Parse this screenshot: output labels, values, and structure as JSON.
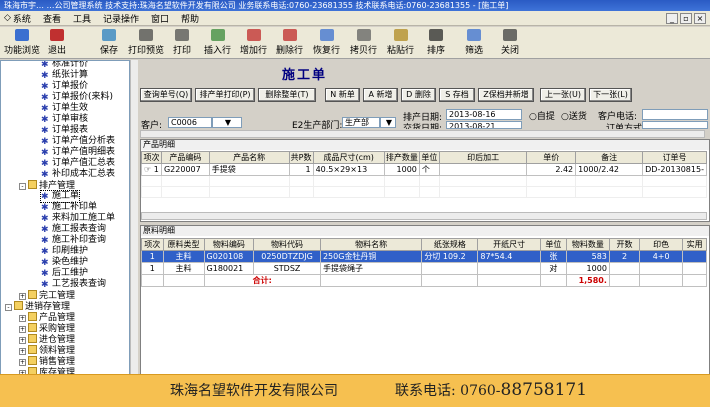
{
  "window": {
    "title": "珠海市宇…   …公司管理系统  技术支持:珠海名望软件开发有限公司  业务联系电话:0760-23681355  技术联系电话:0760-23681355 - [施工单]"
  },
  "menu": [
    "系统",
    "查看",
    "工具",
    "记录操作",
    "窗口",
    "帮助"
  ],
  "toolbar_left": [
    {
      "label": "功能浏览",
      "icon": "browse-icon"
    },
    {
      "label": "退出",
      "icon": "exit-icon"
    }
  ],
  "toolbar": [
    {
      "label": "保存",
      "icon": "save-icon"
    },
    {
      "label": "打印预览",
      "icon": "print-preview-icon"
    },
    {
      "label": "打印",
      "icon": "print-icon"
    },
    {
      "label": "插入行",
      "icon": "insert-row-icon"
    },
    {
      "label": "增加行",
      "icon": "add-row-icon"
    },
    {
      "label": "删除行",
      "icon": "delete-row-icon"
    },
    {
      "label": "恢复行",
      "icon": "restore-row-icon"
    },
    {
      "label": "拷贝行",
      "icon": "copy-row-icon"
    },
    {
      "label": "粘贴行",
      "icon": "paste-row-icon"
    },
    {
      "label": "排序",
      "icon": "sort-icon"
    },
    {
      "label": "筛选",
      "icon": "filter-icon"
    },
    {
      "label": "关闭",
      "icon": "close-icon"
    }
  ],
  "tree": [
    {
      "label": "标准计价",
      "type": "leaf",
      "level": 2
    },
    {
      "label": "纸张计算",
      "type": "leaf",
      "level": 2
    },
    {
      "label": "订单报价",
      "type": "leaf",
      "level": 2
    },
    {
      "label": "订单报价(来料)",
      "type": "leaf",
      "level": 2
    },
    {
      "label": "订单生效",
      "type": "leaf",
      "level": 2
    },
    {
      "label": "订单审核",
      "type": "leaf",
      "level": 2
    },
    {
      "label": "订单报表",
      "type": "leaf",
      "level": 2
    },
    {
      "label": "订单产值分析表",
      "type": "leaf",
      "level": 2
    },
    {
      "label": "订单产值明细表",
      "type": "leaf",
      "level": 2
    },
    {
      "label": "订单产值汇总表",
      "type": "leaf",
      "level": 2
    },
    {
      "label": "补印成本汇总表",
      "type": "leaf",
      "level": 2
    },
    {
      "label": "排产管理",
      "type": "folder",
      "level": 1,
      "expander": "-"
    },
    {
      "label": "施工单",
      "type": "leaf",
      "level": 2
    },
    {
      "label": "施工补印单",
      "type": "leaf",
      "level": 2
    },
    {
      "label": "来料加工施工单",
      "type": "leaf",
      "level": 2
    },
    {
      "label": "施工报表查询",
      "type": "leaf",
      "level": 2
    },
    {
      "label": "施工补印查询",
      "type": "leaf",
      "level": 2
    },
    {
      "label": "印刷维护",
      "type": "leaf",
      "level": 2
    },
    {
      "label": "染色维护",
      "type": "leaf",
      "level": 2
    },
    {
      "label": "后工维护",
      "type": "leaf",
      "level": 2
    },
    {
      "label": "工艺报表查询",
      "type": "leaf",
      "level": 2
    },
    {
      "label": "完工管理",
      "type": "folder",
      "level": 1,
      "expander": "+"
    },
    {
      "label": "进销存管理",
      "type": "folder",
      "level": 0,
      "expander": "-"
    },
    {
      "label": "产品管理",
      "type": "folder",
      "level": 1,
      "expander": "+"
    },
    {
      "label": "采购管理",
      "type": "folder",
      "level": 1,
      "expander": "+"
    },
    {
      "label": "进仓管理",
      "type": "folder",
      "level": 1,
      "expander": "+"
    },
    {
      "label": "领料管理",
      "type": "folder",
      "level": 1,
      "expander": "+"
    },
    {
      "label": "销售管理",
      "type": "folder",
      "level": 1,
      "expander": "+"
    },
    {
      "label": "库存管理",
      "type": "folder",
      "level": 1,
      "expander": "+"
    },
    {
      "label": "委外加工",
      "type": "folder",
      "level": 1,
      "expander": "+"
    }
  ],
  "form": {
    "title": "施工单",
    "buttons_row1": [
      "查询单号(Q)",
      "排产单打印(P)",
      "删除整单(T)"
    ],
    "buttons_row1b": [
      "N 新单",
      "A 新增",
      "D 删除",
      "S 存档",
      "Z保档并新增"
    ],
    "nav_buttons": [
      "上一张(U)",
      "下一张(L)"
    ],
    "schedule_date_label": "排产日期:",
    "schedule_date": "2013-08-16",
    "order_date_label": "交货日期:",
    "order_date": "2013-08-21",
    "radio_self": "自提",
    "radio_delivery": "送货",
    "customer_phone_label": "客户电话:",
    "customer_label": "客户:",
    "customer_value": "C0006",
    "dept_label": "E2生产部门:",
    "dept_value": "生产部",
    "order_method_label": "订单方式"
  },
  "product_section": {
    "title": "产品明细",
    "columns": [
      "项次",
      "产品编码",
      "产品名称",
      "共P数",
      "成品尺寸(cm)",
      "排产数量",
      "单位",
      "印后加工",
      "单价",
      "备注",
      "订单号"
    ],
    "rows": [
      [
        "1",
        "G220007",
        "手提袋",
        "1",
        "40.5×29×13",
        "1000",
        "个",
        "",
        "2.42",
        "1000/2.42",
        "DD-20130815-"
      ]
    ]
  },
  "material_section": {
    "title": "原料明细",
    "columns": [
      "项次",
      "原料类型",
      "物料编码",
      "物料代码",
      "物料名称",
      "纸张规格",
      "开纸尺寸",
      "单位",
      "物料数量",
      "开数",
      "印色",
      "实用"
    ],
    "rows": [
      [
        "1",
        "主料",
        "G020108",
        "0250DTZDJG",
        "250G金牡丹铜",
        "分切 109.2",
        "87*54.4",
        "张",
        "583",
        "2",
        "4+0",
        ""
      ],
      [
        "1",
        "主料",
        "G180021",
        "STDSZ",
        "手提袋绳子",
        "",
        "",
        "对",
        "1000",
        "",
        "",
        ""
      ]
    ],
    "total_label": "合计:",
    "total_value": "1,580."
  },
  "footer": {
    "company": "珠海名望软件开发有限公司",
    "phone_label": "联系电话:",
    "phone_prefix": "0760-",
    "phone_number": "88758171"
  }
}
